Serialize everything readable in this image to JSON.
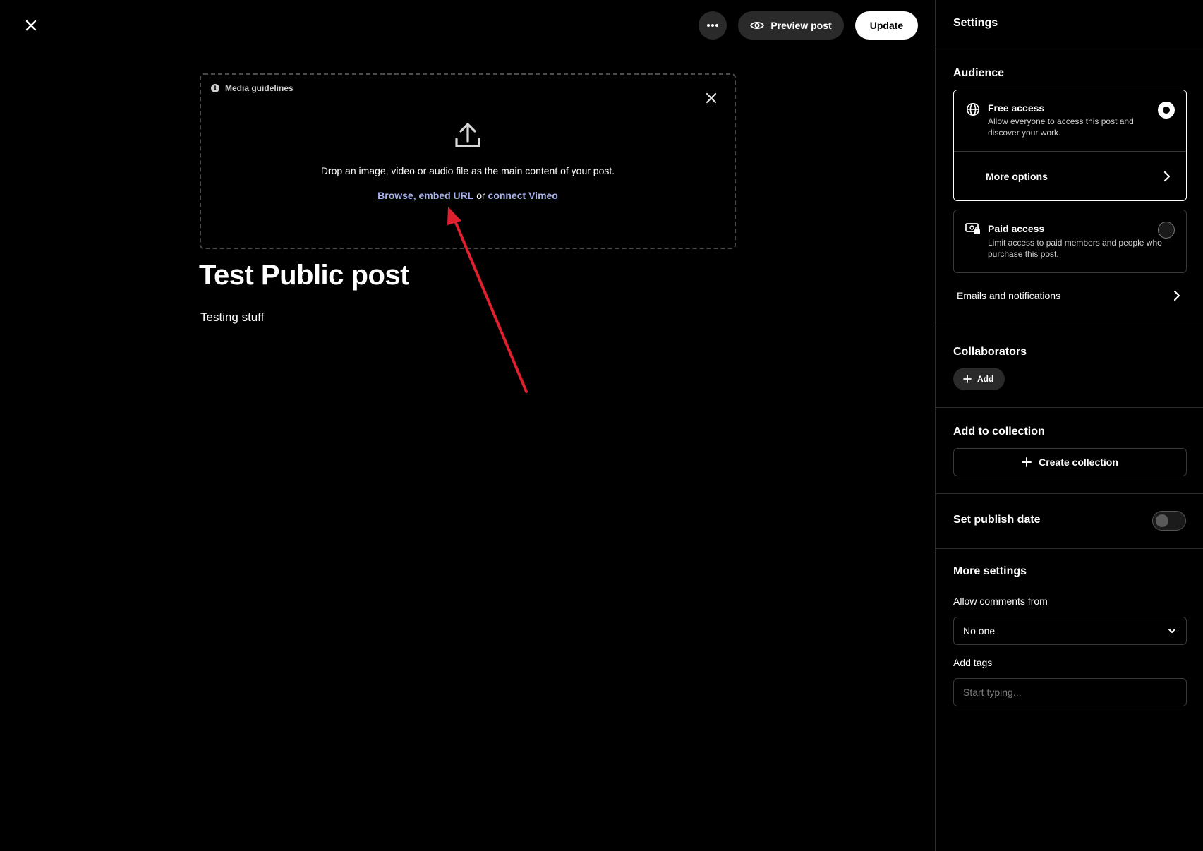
{
  "header": {
    "preview_label": "Preview post",
    "update_label": "Update"
  },
  "editor": {
    "media_guidelines": "Media guidelines",
    "drop_text": "Drop an image, video or audio file as the main content of your post.",
    "browse_link": "Browse,",
    "embed_link": "embed URL",
    "or_text": "or",
    "vimeo_link": "connect Vimeo",
    "title": "Test Public post",
    "body": "Testing stuff"
  },
  "settings": {
    "title": "Settings",
    "audience": {
      "heading": "Audience",
      "free": {
        "title": "Free access",
        "description": "Allow everyone to access this post and discover your work.",
        "selected": true
      },
      "more_options": "More options",
      "paid": {
        "title": "Paid access",
        "description": "Limit access to paid members and people who purchase this post.",
        "selected": false
      },
      "emails": "Emails and notifications"
    },
    "collaborators": {
      "heading": "Collaborators",
      "add_label": "Add"
    },
    "collection": {
      "heading": "Add to collection",
      "create_label": "Create collection"
    },
    "publish_date": {
      "heading": "Set publish date",
      "enabled": false
    },
    "more_settings": {
      "heading": "More settings",
      "comments_label": "Allow comments from",
      "comments_value": "No one",
      "tags_label": "Add tags",
      "tags_placeholder": "Start typing..."
    }
  },
  "colors": {
    "background": "#000000",
    "link": "#a8b1ea",
    "annotation_arrow": "#e0202e"
  }
}
